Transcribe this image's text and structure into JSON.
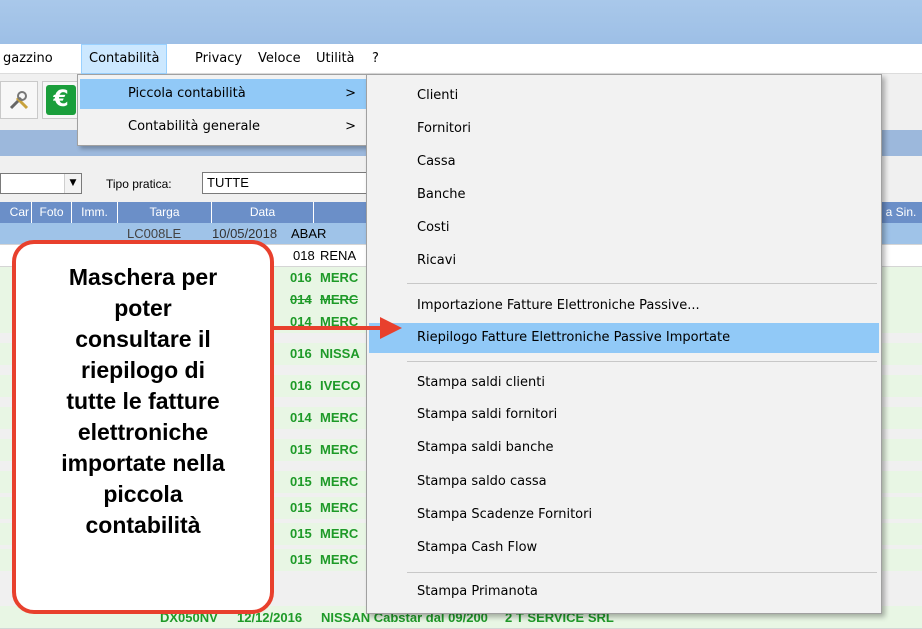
{
  "menubar": {
    "items": [
      "gazzino",
      "Contabilità",
      "Privacy",
      "Veloce",
      "Utilità",
      "?"
    ]
  },
  "toolbar": {
    "icons": [
      "tools-icon",
      "euro-icon"
    ],
    "euro_glyph": "€"
  },
  "filter": {
    "tipo_pratica_label": "Tipo pratica:",
    "tipo_pratica_value": "TUTTE"
  },
  "grid": {
    "headers": [
      "Car",
      "Foto",
      "Imm.",
      "Targa",
      "Data",
      "a Sin."
    ],
    "rows": [
      {
        "targa": "LC008LE",
        "data": "10/05/2018",
        "desc": "ABAR"
      },
      {
        "data": "018",
        "desc": "RENA"
      },
      {
        "data": "016",
        "desc": "MERC"
      },
      {
        "data": "014",
        "desc": "MERC"
      },
      {
        "data": "014",
        "desc": "MERC"
      },
      {
        "data": "016",
        "desc": "NISSA"
      },
      {
        "data": "016",
        "desc": "IVECO"
      },
      {
        "data": "014",
        "desc": "MERC"
      },
      {
        "data": "015",
        "desc": "MERC"
      },
      {
        "data": "015",
        "desc": "MERC"
      },
      {
        "data": "015",
        "desc": "MERC"
      },
      {
        "data": "015",
        "desc": "MERC"
      },
      {
        "data": "015",
        "desc": "MERC"
      },
      {
        "targa": "DX050NV",
        "data": "12/12/2016",
        "desc": "NISSAN Cabstar dal 09/200",
        "owner": "2 T SERVICE SRL"
      }
    ]
  },
  "submenu": {
    "items": [
      "Piccola contabilità",
      "Contabilità generale"
    ],
    "chevron": ">"
  },
  "menu": {
    "group1": [
      "Clienti",
      "Fornitori",
      "Cassa",
      "Banche",
      "Costi",
      "Ricavi"
    ],
    "group2": [
      "Importazione Fatture Elettroniche Passive...",
      "Riepilogo Fatture Elettroniche Passive Importate"
    ],
    "group3": [
      "Stampa saldi clienti",
      "Stampa saldi fornitori",
      "Stampa saldi banche",
      "Stampa saldo cassa",
      "Stampa Scadenze Fornitori",
      "Stampa Cash Flow"
    ],
    "group4": [
      "Stampa Primanota"
    ]
  },
  "callout": {
    "lines": [
      "Maschera per",
      "poter",
      "consultare il",
      "riepilogo di",
      "tutte le fatture",
      "elettroniche",
      "importate nella",
      "piccola",
      "contabilità"
    ]
  },
  "colors": {
    "accent": "#e8402d",
    "highlight": "#91c9f7",
    "gridhead": "#6b8fc8"
  }
}
